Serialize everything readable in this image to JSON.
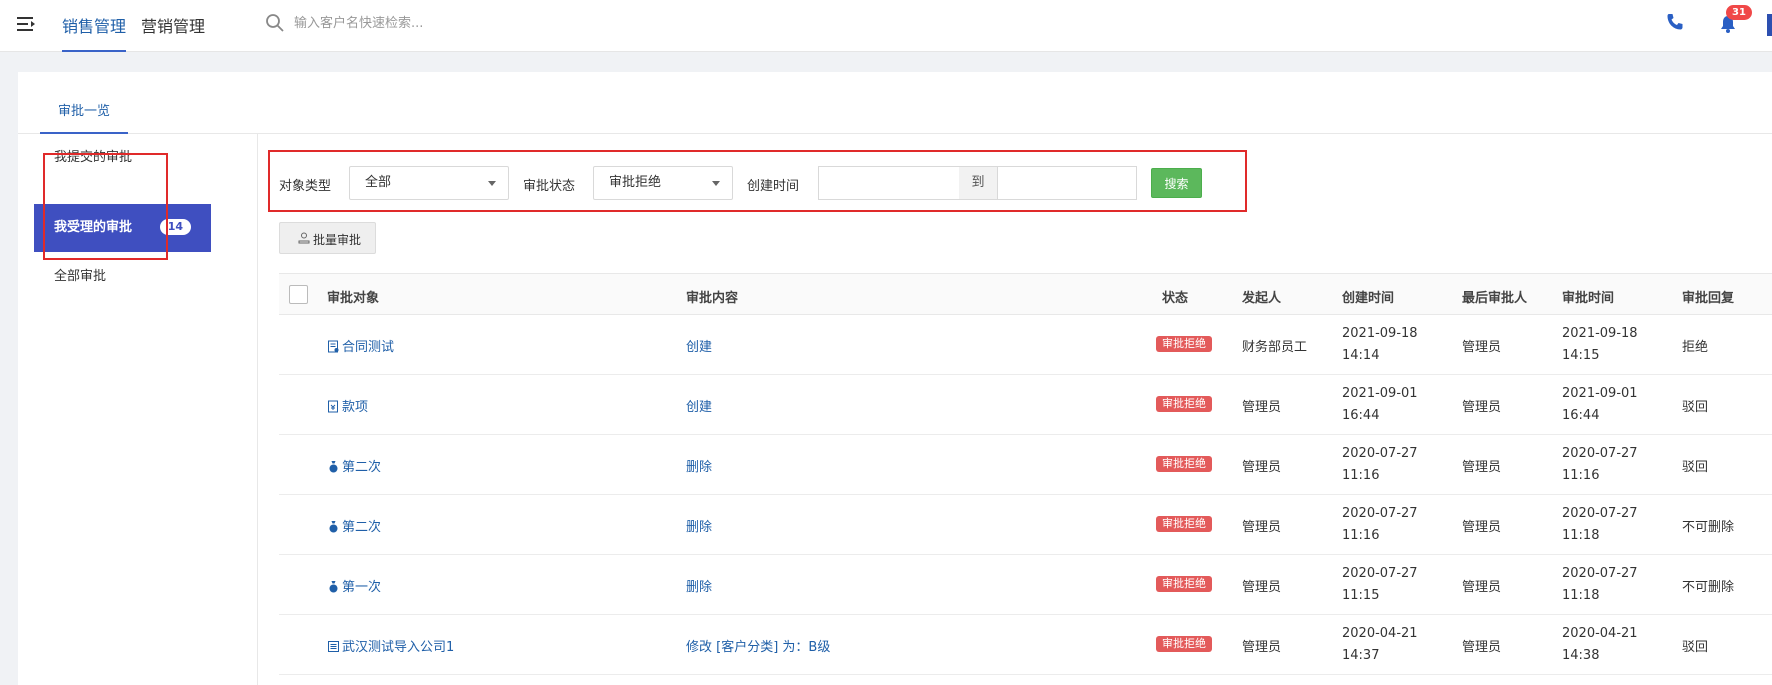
{
  "topbar": {
    "nav": [
      {
        "label": "销售管理",
        "active": true
      },
      {
        "label": "营销管理",
        "active": false
      }
    ],
    "search_placeholder": "输入客户名快速检索...",
    "notification_count": "31",
    "icons": [
      "menu-toggle-icon",
      "search-icon",
      "phone-icon",
      "bell-icon"
    ]
  },
  "tabs": [
    {
      "label": "审批一览"
    }
  ],
  "sidebar": {
    "items": [
      {
        "label": "我提交的审批",
        "active": false,
        "count": null
      },
      {
        "label": "我受理的审批",
        "active": true,
        "count": "14"
      },
      {
        "label": "全部审批",
        "active": false,
        "count": null
      }
    ]
  },
  "filters": {
    "object_type_label": "对象类型",
    "object_type_value": "全部",
    "status_label": "审批状态",
    "status_value": "审批拒绝",
    "created_label": "创建时间",
    "date_from": "",
    "date_sep": "到",
    "date_to": "",
    "search_label": "搜索"
  },
  "batch_label": "批量审批",
  "table": {
    "columns": [
      "审批对象",
      "审批内容",
      "状态",
      "发起人",
      "创建时间",
      "最后审批人",
      "审批时间",
      "审批回复"
    ],
    "rows": [
      {
        "icon": "contract-icon",
        "object": "合同测试",
        "content": "创建",
        "status": "审批拒绝",
        "initiator": "财务部员工",
        "created_date": "2021-09-18",
        "created_time": "14:14",
        "last_approver": "管理员",
        "approved_date": "2021-09-18",
        "approved_time": "14:15",
        "reply": "拒绝"
      },
      {
        "icon": "payment-icon",
        "object": "款项",
        "content": "创建",
        "status": "审批拒绝",
        "initiator": "管理员",
        "created_date": "2021-09-01",
        "created_time": "16:44",
        "last_approver": "管理员",
        "approved_date": "2021-09-01",
        "approved_time": "16:44",
        "reply": "驳回"
      },
      {
        "icon": "money-bag-icon",
        "object": "第二次",
        "content": "删除",
        "status": "审批拒绝",
        "initiator": "管理员",
        "created_date": "2020-07-27",
        "created_time": "11:16",
        "last_approver": "管理员",
        "approved_date": "2020-07-27",
        "approved_time": "11:16",
        "reply": "驳回"
      },
      {
        "icon": "money-bag-icon",
        "object": "第二次",
        "content": "删除",
        "status": "审批拒绝",
        "initiator": "管理员",
        "created_date": "2020-07-27",
        "created_time": "11:16",
        "last_approver": "管理员",
        "approved_date": "2020-07-27",
        "approved_time": "11:18",
        "reply": "不可删除"
      },
      {
        "icon": "money-bag-icon",
        "object": "第一次",
        "content": "删除",
        "status": "审批拒绝",
        "initiator": "管理员",
        "created_date": "2020-07-27",
        "created_time": "11:15",
        "last_approver": "管理员",
        "approved_date": "2020-07-27",
        "approved_time": "11:18",
        "reply": "不可删除"
      },
      {
        "icon": "company-icon",
        "object": "武汉测试导入公司1",
        "content": "修改 [客户分类] 为：B级",
        "status": "审批拒绝",
        "initiator": "管理员",
        "created_date": "2020-04-21",
        "created_time": "14:37",
        "last_approver": "管理员",
        "approved_date": "2020-04-21",
        "approved_time": "14:38",
        "reply": "驳回"
      }
    ]
  },
  "colors": {
    "accent": "#3f4fc0",
    "link": "#1f5fa8",
    "status_red": "#e35a5a",
    "search_green": "#5cb85c",
    "highlight_red": "#e02a2a"
  }
}
